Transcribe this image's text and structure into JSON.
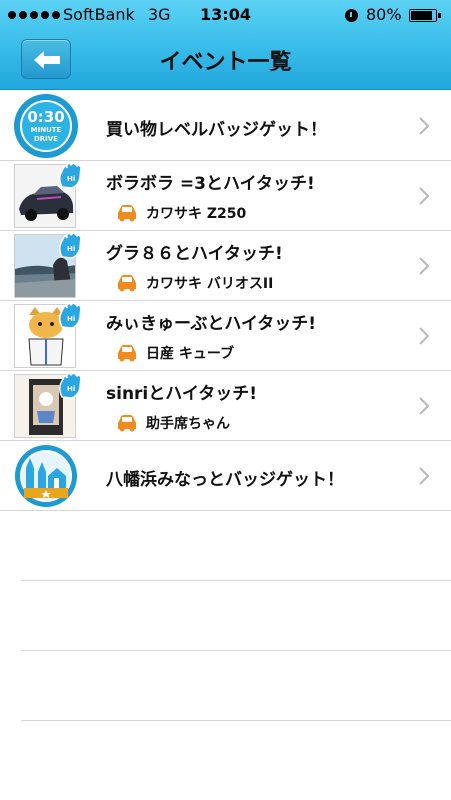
{
  "status": {
    "carrier": "SoftBank",
    "network": "3G",
    "time": "13:04",
    "battery": "80%",
    "battery_level": 0.8
  },
  "nav": {
    "title": "イベント一覧"
  },
  "events": [
    {
      "title": "買い物レベルバッジゲット！",
      "badge_text": {
        "line1": "0:30",
        "line2": "MINUTE",
        "line3": "DRIVE"
      }
    },
    {
      "title": "ボラボラ =3とハイタッチ!",
      "car": "カワサキ Z250"
    },
    {
      "title": "グラ８６とハイタッチ!",
      "car": "カワサキ バリオスII"
    },
    {
      "title": "みぃきゅーぶとハイタッチ!",
      "car": "日産 キューブ"
    },
    {
      "title": "sinriとハイタッチ!",
      "car": "助手席ちゃん"
    },
    {
      "title": "八幡浜みなっとバッジゲット！"
    }
  ],
  "colors": {
    "header_top": "#5cd2f4",
    "header_bottom": "#21a7dc",
    "car_icon": "#f28a1e",
    "hand_icon": "#2aa6e0"
  }
}
